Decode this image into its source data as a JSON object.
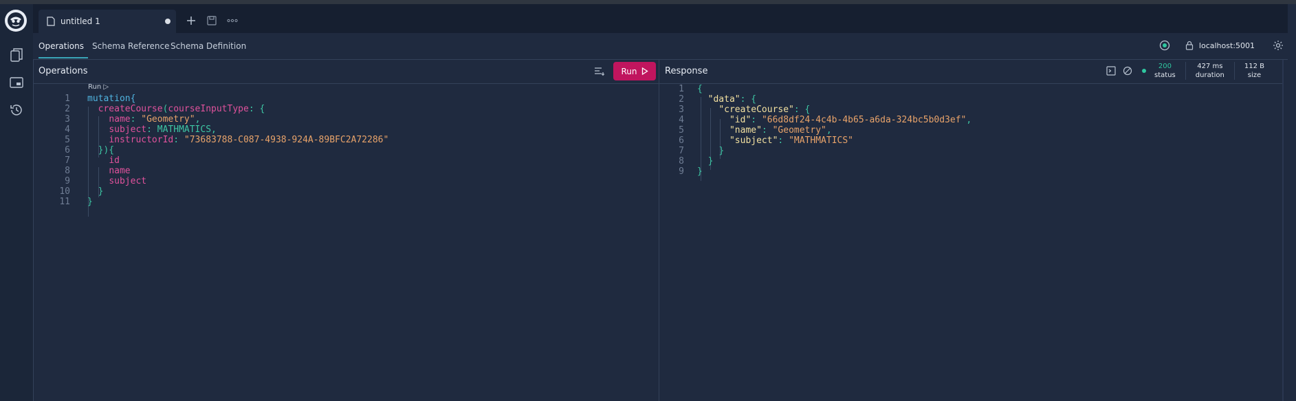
{
  "tab": {
    "title": "untitled 1"
  },
  "menu": {
    "tabs": [
      "Operations",
      "Schema Reference",
      "Schema Definition"
    ],
    "active": "Operations"
  },
  "connection": {
    "endpoint": "localhost:5001"
  },
  "operations": {
    "title": "Operations",
    "run_label": "Run",
    "run_hint": "Run ▷",
    "lines": [
      [
        {
          "t": "mutation",
          "c": "kw"
        },
        {
          "t": "{",
          "c": "kw"
        }
      ],
      [
        {
          "t": "  ",
          "c": ""
        },
        {
          "t": "createCourse",
          "c": "fn"
        },
        {
          "t": "(",
          "c": "pn"
        },
        {
          "t": "courseInputType",
          "c": "arg"
        },
        {
          "t": ": {",
          "c": "pn"
        }
      ],
      [
        {
          "t": "    ",
          "c": ""
        },
        {
          "t": "name",
          "c": "arg"
        },
        {
          "t": ": ",
          "c": "pn"
        },
        {
          "t": "\"Geometry\"",
          "c": "str"
        },
        {
          "t": ",",
          "c": "pn"
        }
      ],
      [
        {
          "t": "    ",
          "c": ""
        },
        {
          "t": "subject",
          "c": "arg"
        },
        {
          "t": ": ",
          "c": "pn"
        },
        {
          "t": "MATHMATICS",
          "c": "enm"
        },
        {
          "t": ",",
          "c": "pn"
        }
      ],
      [
        {
          "t": "    ",
          "c": ""
        },
        {
          "t": "instructorId",
          "c": "arg"
        },
        {
          "t": ": ",
          "c": "pn"
        },
        {
          "t": "\"73683788-C087-4938-924A-89BFC2A72286\"",
          "c": "str"
        }
      ],
      [
        {
          "t": "  ",
          "c": ""
        },
        {
          "t": "}){",
          "c": "pn"
        }
      ],
      [
        {
          "t": "    ",
          "c": ""
        },
        {
          "t": "id",
          "c": "fn"
        }
      ],
      [
        {
          "t": "    ",
          "c": ""
        },
        {
          "t": "name",
          "c": "fn"
        }
      ],
      [
        {
          "t": "    ",
          "c": ""
        },
        {
          "t": "subject",
          "c": "fn"
        }
      ],
      [
        {
          "t": "  ",
          "c": ""
        },
        {
          "t": "}",
          "c": "pn"
        }
      ],
      [
        {
          "t": "}",
          "c": "pn"
        }
      ]
    ]
  },
  "response": {
    "title": "Response",
    "status": {
      "value": "200",
      "label": "status"
    },
    "duration": {
      "value": "427 ms",
      "label": "duration"
    },
    "size": {
      "value": "112 B",
      "label": "size"
    },
    "lines": [
      [
        {
          "t": "{",
          "c": "pn"
        }
      ],
      [
        {
          "t": "  ",
          "c": ""
        },
        {
          "t": "\"data\"",
          "c": "key"
        },
        {
          "t": ": {",
          "c": "pn"
        }
      ],
      [
        {
          "t": "    ",
          "c": ""
        },
        {
          "t": "\"createCourse\"",
          "c": "key"
        },
        {
          "t": ": {",
          "c": "pn"
        }
      ],
      [
        {
          "t": "      ",
          "c": ""
        },
        {
          "t": "\"id\"",
          "c": "key"
        },
        {
          "t": ": ",
          "c": "pn"
        },
        {
          "t": "\"66d8df24-4c4b-4b65-a6da-324bc5b0d3ef\"",
          "c": "str"
        },
        {
          "t": ",",
          "c": "pn"
        }
      ],
      [
        {
          "t": "      ",
          "c": ""
        },
        {
          "t": "\"name\"",
          "c": "key"
        },
        {
          "t": ": ",
          "c": "pn"
        },
        {
          "t": "\"Geometry\"",
          "c": "str"
        },
        {
          "t": ",",
          "c": "pn"
        }
      ],
      [
        {
          "t": "      ",
          "c": ""
        },
        {
          "t": "\"subject\"",
          "c": "key"
        },
        {
          "t": ": ",
          "c": "pn"
        },
        {
          "t": "\"MATHMATICS\"",
          "c": "str"
        }
      ],
      [
        {
          "t": "    ",
          "c": ""
        },
        {
          "t": "}",
          "c": "pn"
        }
      ],
      [
        {
          "t": "  ",
          "c": ""
        },
        {
          "t": "}",
          "c": "pn"
        }
      ],
      [
        {
          "t": "}",
          "c": "pn"
        }
      ]
    ]
  },
  "colors": {
    "accent": "#c0155e",
    "status_ok": "#2fc7a0",
    "background": "#1f2a3f"
  }
}
